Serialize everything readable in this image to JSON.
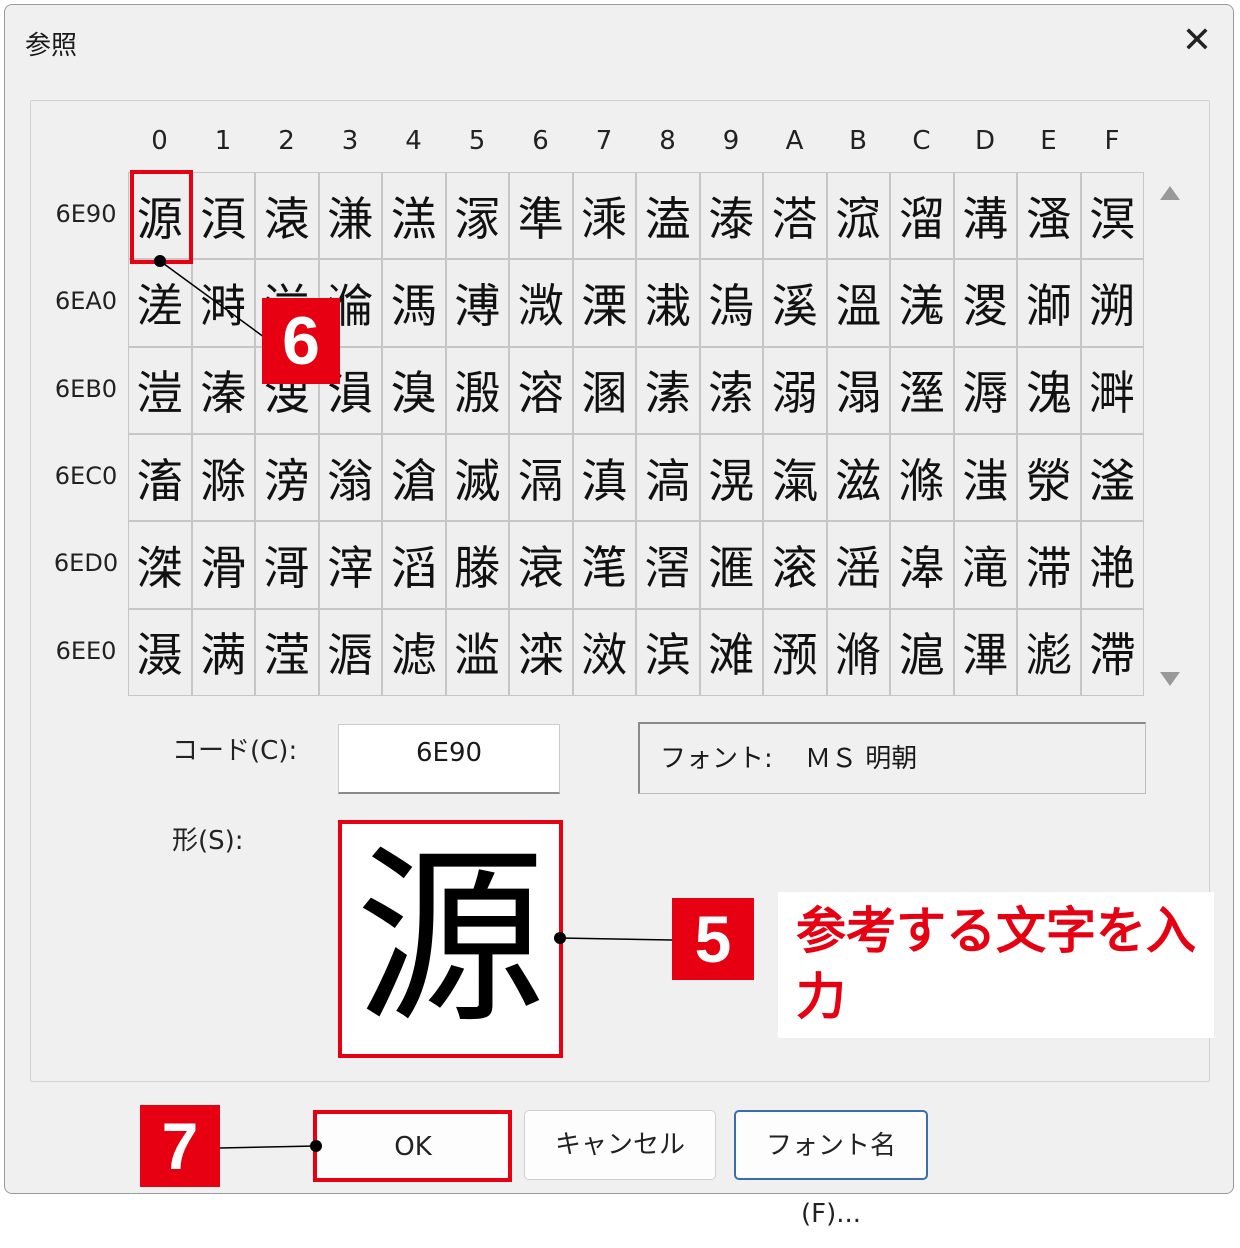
{
  "dialog": {
    "title": "参照",
    "close_icon": "close-icon"
  },
  "grid": {
    "columns": [
      "0",
      "1",
      "2",
      "3",
      "4",
      "5",
      "6",
      "7",
      "8",
      "9",
      "A",
      "B",
      "C",
      "D",
      "E",
      "F"
    ],
    "rows": [
      {
        "code": "6E90",
        "chars": [
          "源",
          "湏",
          "溒",
          "溓",
          "溔",
          "溕",
          "準",
          "溗",
          "溘",
          "溙",
          "溚",
          "溛",
          "溜",
          "溝",
          "溞",
          "溟"
        ]
      },
      {
        "code": "6EA0",
        "chars": [
          "溠",
          "溡",
          "溢",
          "溣",
          "溤",
          "溥",
          "溦",
          "溧",
          "溨",
          "溩",
          "溪",
          "溫",
          "溬",
          "溭",
          "溮",
          "溯"
        ]
      },
      {
        "code": "6EB0",
        "chars": [
          "溰",
          "溱",
          "溲",
          "溳",
          "溴",
          "溵",
          "溶",
          "溷",
          "溸",
          "溹",
          "溺",
          "溻",
          "溼",
          "溽",
          "溾",
          "溿"
        ]
      },
      {
        "code": "6EC0",
        "chars": [
          "滀",
          "滁",
          "滂",
          "滃",
          "滄",
          "滅",
          "滆",
          "滇",
          "滈",
          "滉",
          "滊",
          "滋",
          "滌",
          "滍",
          "滎",
          "滏"
        ]
      },
      {
        "code": "6ED0",
        "chars": [
          "滐",
          "滑",
          "滒",
          "滓",
          "滔",
          "滕",
          "滖",
          "滗",
          "滘",
          "滙",
          "滚",
          "滛",
          "滜",
          "滝",
          "滞",
          "滟"
        ]
      },
      {
        "code": "6EE0",
        "chars": [
          "滠",
          "满",
          "滢",
          "滣",
          "滤",
          "滥",
          "滦",
          "滧",
          "滨",
          "滩",
          "滪",
          "滫",
          "滬",
          "滭",
          "滮",
          "滯"
        ]
      }
    ],
    "scroll_up_icon": "triangle-up-icon",
    "scroll_down_icon": "triangle-down-icon"
  },
  "code": {
    "label": "コード(C):",
    "value": "6E90"
  },
  "font": {
    "label": "フォント:",
    "value": "ＭＳ 明朝"
  },
  "shape": {
    "label": "形(S):",
    "value": "源"
  },
  "buttons": {
    "ok": "OK",
    "cancel": "キャンセル",
    "font_name": "フォント名(F)..."
  },
  "annotations": {
    "badge5": "5",
    "badge6": "6",
    "badge7": "7",
    "note": "参考する文字を入力",
    "accent_color": "#e60012"
  }
}
